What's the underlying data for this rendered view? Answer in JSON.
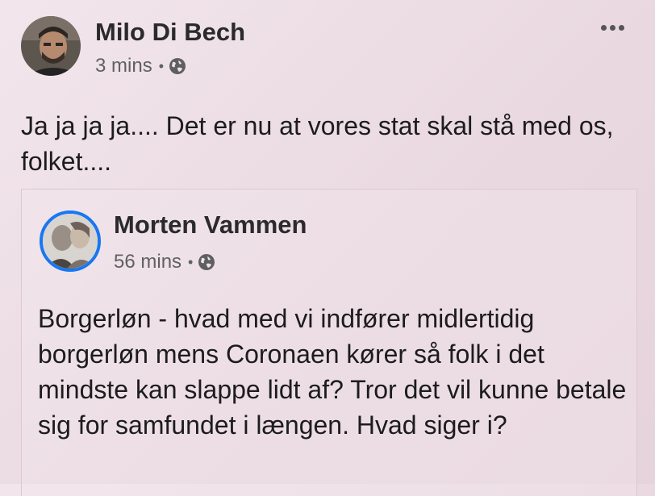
{
  "post": {
    "author": "Milo Di Bech",
    "time": "3 mins",
    "separator": "•",
    "privacy_icon": "globe-icon",
    "more_icon": "more-horizontal-icon",
    "text": "Ja ja ja ja.... Det er nu at vores stat skal stå med os, folket...."
  },
  "shared_post": {
    "author": "Morten Vammen",
    "time": "56 mins",
    "separator": "•",
    "privacy_icon": "globe-icon",
    "text": "Borgerløn - hvad med vi indfører midlertidig borgerløn mens Coronaen kører så folk i det mindste kan slappe lidt af? Tror det vil kunne betale sig for samfundet i længen. Hvad siger i?"
  },
  "colors": {
    "background": "#eddde5",
    "text": "#1c1c1c",
    "meta": "#606060",
    "avatar_ring": "#1877f2"
  }
}
